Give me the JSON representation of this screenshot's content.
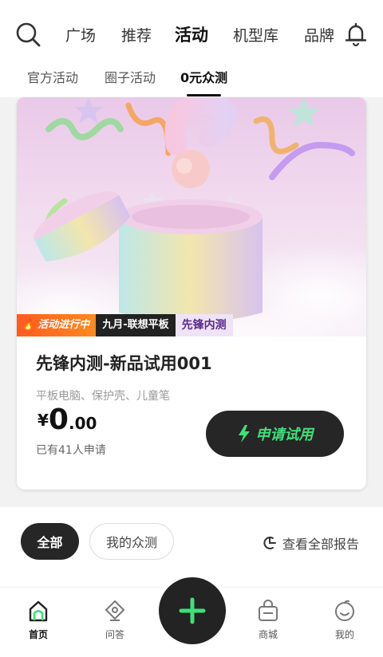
{
  "top_nav": {
    "tabs": [
      {
        "label": "广场"
      },
      {
        "label": "推荐"
      },
      {
        "label": "活动",
        "active": true
      },
      {
        "label": "机型库"
      },
      {
        "label": "品牌"
      }
    ]
  },
  "sub_nav": {
    "tabs": [
      {
        "label": "官方活动"
      },
      {
        "label": "圈子活动"
      },
      {
        "label": "0元众测",
        "active": true
      }
    ]
  },
  "card": {
    "badges": {
      "status": "活动进行中",
      "month": "九月-联想平板",
      "type": "先锋内测"
    },
    "title": "先锋内测-新品试用001",
    "tags": "平板电脑、保护壳、儿童笔",
    "price": {
      "currency": "¥",
      "integer": "0",
      "decimal": ".00"
    },
    "applicants": "已有41人申请",
    "apply_label": "申请试用"
  },
  "filters": {
    "all_label": "全部",
    "mine_label": "我的众测",
    "report_label": "查看全部报告"
  },
  "bottom_nav": {
    "items": [
      {
        "label": "首页",
        "icon": "home-icon",
        "active": true
      },
      {
        "label": "问答",
        "icon": "qa-icon"
      },
      {
        "label": "商城",
        "icon": "shop-icon"
      },
      {
        "label": "我的",
        "icon": "profile-icon"
      }
    ]
  },
  "colors": {
    "accent": "#3ee07a",
    "dark": "#262626",
    "live_badge": "#ff6a1f"
  }
}
